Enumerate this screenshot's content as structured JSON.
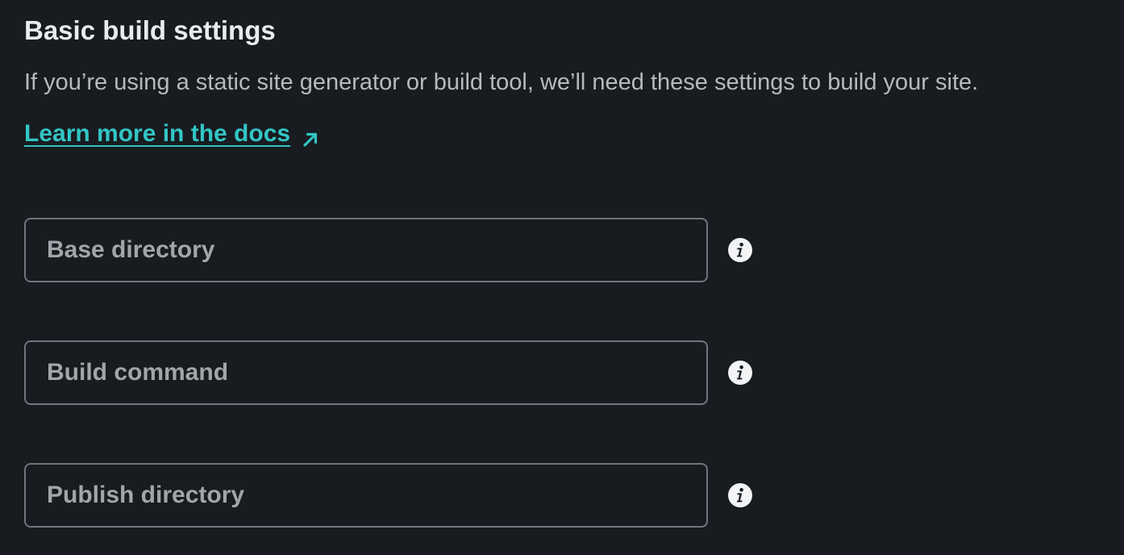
{
  "section": {
    "title": "Basic build settings",
    "description": "If you’re using a static site generator or build tool, we’ll need these settings to build your site.",
    "docs_link": {
      "label": "Learn more in the docs",
      "icon": "arrow-up-right-icon"
    }
  },
  "fields": [
    {
      "placeholder": "Base directory",
      "value": "",
      "icon": "info-icon"
    },
    {
      "placeholder": "Build command",
      "value": "",
      "icon": "info-icon"
    },
    {
      "placeholder": "Publish directory",
      "value": "",
      "icon": "info-icon"
    }
  ],
  "colors": {
    "background": "#181b20",
    "heading": "#e9ebed",
    "body_text": "#b6b9bd",
    "link": "#32c5c5",
    "input_border": "#70757c",
    "placeholder": "#a2a6ab"
  }
}
